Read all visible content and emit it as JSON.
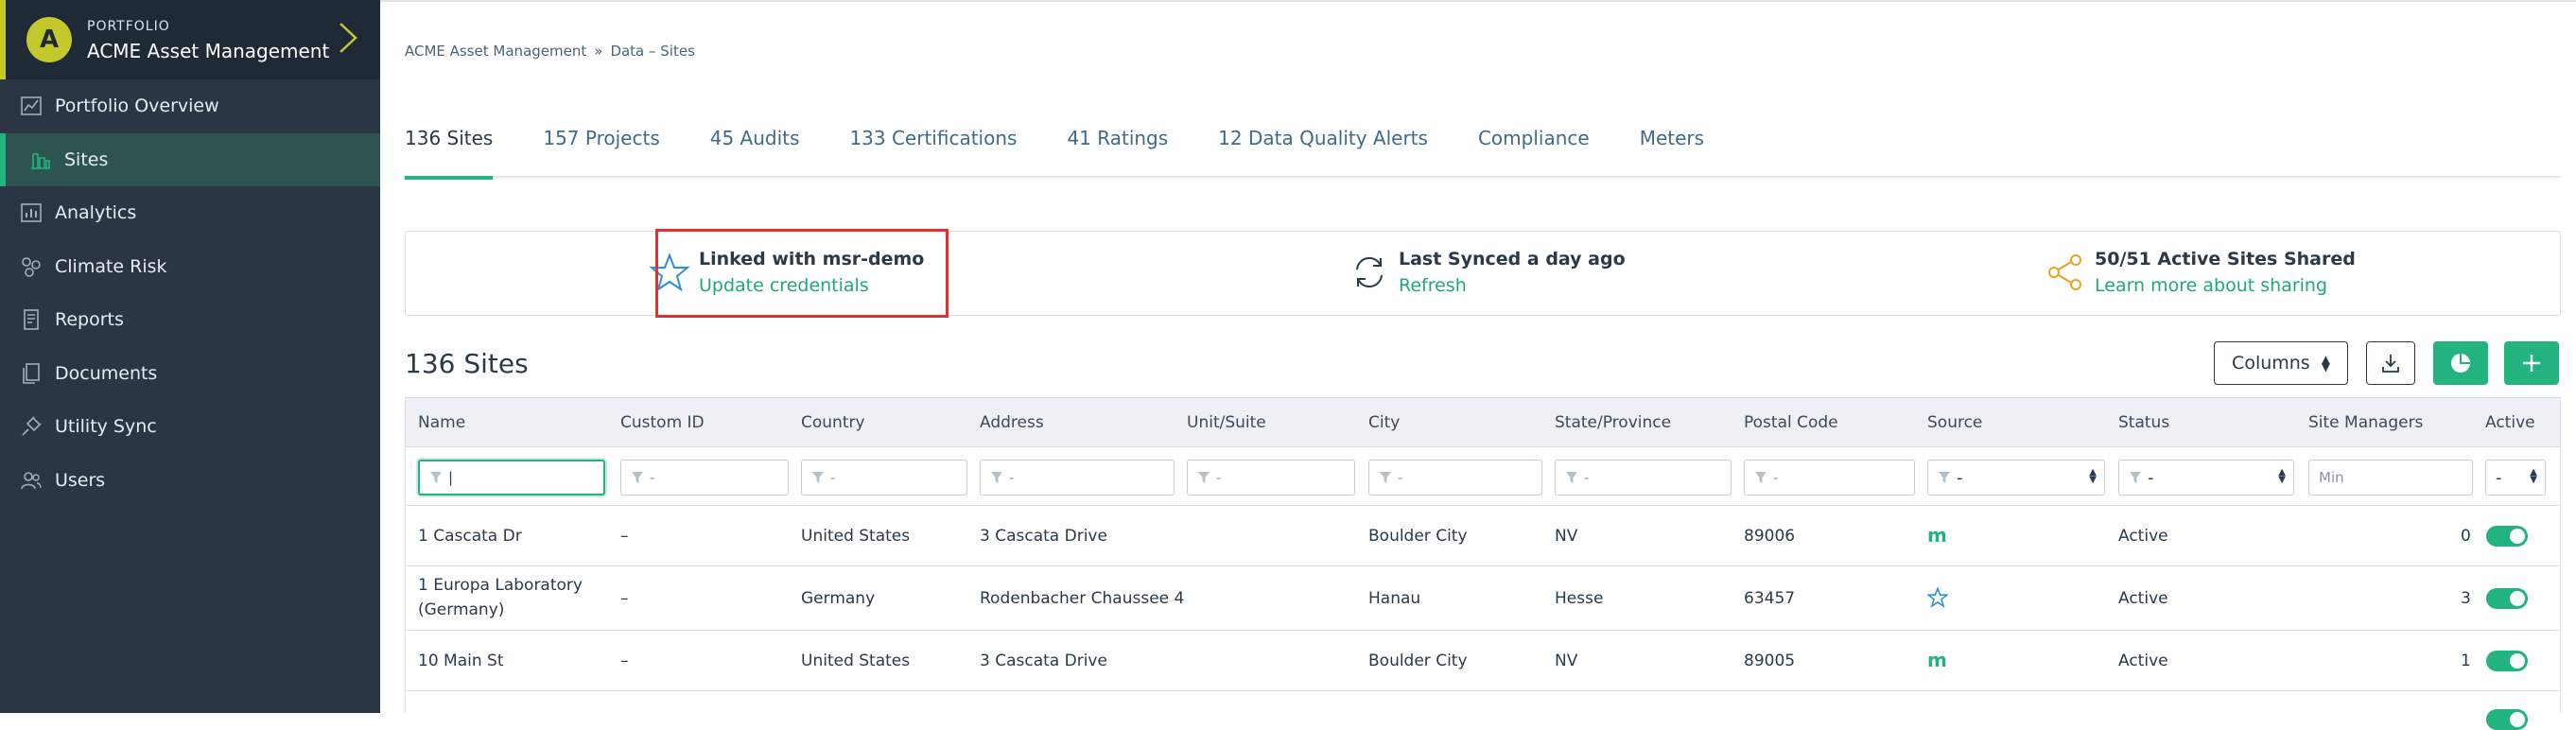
{
  "portfolio": {
    "avatar_letter": "A",
    "label": "PORTFOLIO",
    "name": "ACME Asset Management"
  },
  "sidebar": {
    "items": [
      {
        "label": "Portfolio Overview",
        "icon": "chart-icon"
      },
      {
        "label": "Sites",
        "icon": "buildings-icon",
        "active": true
      },
      {
        "label": "Analytics",
        "icon": "bar-chart-icon"
      },
      {
        "label": "Climate Risk",
        "icon": "hazard-icon"
      },
      {
        "label": "Reports",
        "icon": "report-icon"
      },
      {
        "label": "Documents",
        "icon": "documents-icon"
      },
      {
        "label": "Utility Sync",
        "icon": "plug-icon"
      },
      {
        "label": "Users",
        "icon": "users-icon"
      }
    ]
  },
  "breadcrumb": {
    "root": "ACME Asset Management",
    "sep": "»",
    "current": "Data – Sites"
  },
  "tabs": [
    {
      "label": "136 Sites",
      "active": true
    },
    {
      "label": "157 Projects"
    },
    {
      "label": "45 Audits"
    },
    {
      "label": "133 Certifications"
    },
    {
      "label": "41 Ratings"
    },
    {
      "label": "12 Data Quality Alerts"
    },
    {
      "label": "Compliance"
    },
    {
      "label": "Meters"
    }
  ],
  "infobar": {
    "linked": {
      "title": "Linked with msr-demo",
      "link": "Update credentials"
    },
    "synced": {
      "title": "Last Synced a day ago",
      "link": "Refresh"
    },
    "shared": {
      "title": "50/51 Active Sites Shared",
      "link": "Learn more about sharing"
    }
  },
  "sites": {
    "title": "136 Sites",
    "columns_button": "Columns"
  },
  "table": {
    "headers": [
      "Name",
      "Custom ID",
      "Country",
      "Address",
      "Unit/Suite",
      "City",
      "State/Province",
      "Postal Code",
      "Source",
      "Status",
      "Site Managers",
      "Active"
    ],
    "filters": {
      "placeholder": "-",
      "name_value": "|",
      "source_value": "-",
      "status_value": "-",
      "managers_placeholder": "Min",
      "active_value": "-"
    },
    "rows": [
      {
        "name": "1 Cascata Dr",
        "custom_id": "–",
        "country": "United States",
        "address": "3 Cascata Drive",
        "unit": "",
        "city": "Boulder City",
        "state": "NV",
        "postal": "89006",
        "source": "m",
        "source_icon": "measurabl-icon",
        "status": "Active",
        "managers": "0"
      },
      {
        "name": "1 Europa Laboratory (Germany)",
        "custom_id": "–",
        "country": "Germany",
        "address": "Rodenbacher Chaussee 4",
        "unit": "",
        "city": "Hanau",
        "state": "Hesse",
        "postal": "63457",
        "source": "",
        "source_icon": "star-icon",
        "status": "Active",
        "managers": "3"
      },
      {
        "name": "10 Main St",
        "custom_id": "–",
        "country": "United States",
        "address": "3 Cascata Drive",
        "unit": "",
        "city": "Boulder City",
        "state": "NV",
        "postal": "89005",
        "source": "m",
        "source_icon": "measurabl-icon",
        "status": "Active",
        "managers": "1"
      }
    ]
  },
  "colors": {
    "sidebar_bg": "#2b3544",
    "accent": "#23b37e",
    "highlight": "#e53030",
    "portfolio_accent": "#c3c92b"
  }
}
